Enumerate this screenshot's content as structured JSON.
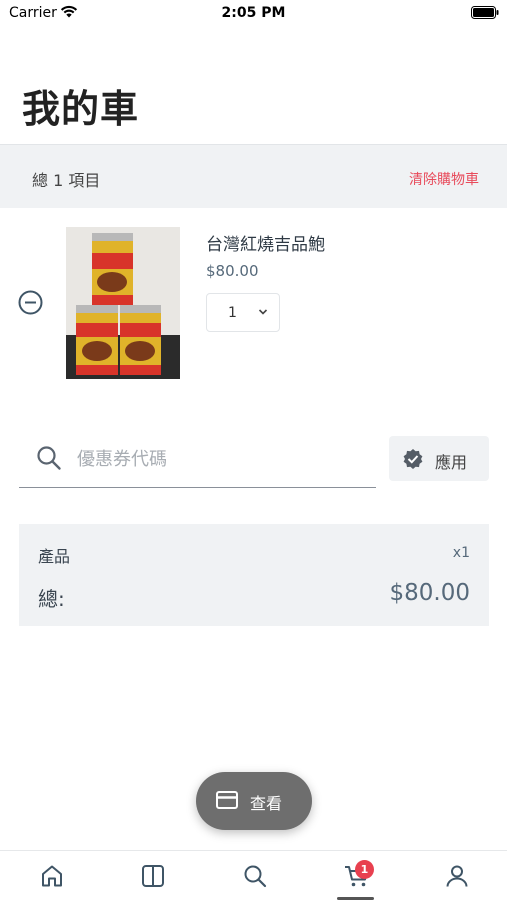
{
  "status_bar": {
    "carrier": "Carrier",
    "time": "2:05 PM"
  },
  "header": {
    "title": "我的車"
  },
  "summary": {
    "label": "總  1 項目",
    "clear_label": "清除購物車",
    "clear_color": "#e84b5b"
  },
  "cart": {
    "items": [
      {
        "name": "台灣紅燒吉品鮑",
        "price": "$80.00",
        "quantity": "1",
        "image": "product-cans-image"
      }
    ]
  },
  "coupon": {
    "placeholder": "優惠券代碼",
    "value": "",
    "apply_label": "應用"
  },
  "totals": {
    "product_label": "產品",
    "product_count": "x1",
    "total_label": "總:",
    "total_amount": "$80.00"
  },
  "view_button": {
    "label": "查看",
    "icon": "card-icon"
  },
  "tab_bar": {
    "tabs": [
      {
        "icon": "home-icon"
      },
      {
        "icon": "catalog-icon"
      },
      {
        "icon": "search-icon"
      },
      {
        "icon": "cart-icon",
        "badge": "1",
        "active": true
      },
      {
        "icon": "account-icon"
      }
    ],
    "badge_color": "#e8404f"
  }
}
